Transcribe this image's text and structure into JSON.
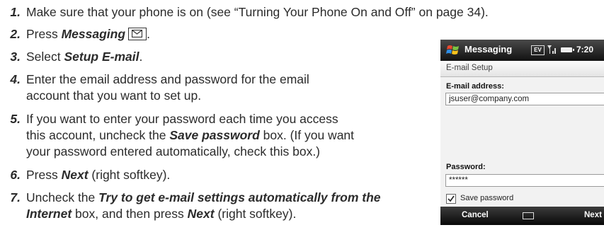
{
  "steps": [
    {
      "number": "1.",
      "parts": [
        "Make sure that your phone is on (see “Turning Your Phone On and Off” on page 34)."
      ]
    },
    {
      "number": "2.",
      "before": "Press ",
      "em": "Messaging",
      "key_icon": "envelope-icon"
    },
    {
      "number": "3.",
      "before": "Select ",
      "em": "Setup E-mail",
      "after": "."
    },
    {
      "number": "4.",
      "lines": [
        "Enter the email address and password for the email",
        "account that you want to set up."
      ]
    },
    {
      "number": "5.",
      "line1": "If you want to enter your password each time you access",
      "line2_before": "this account, uncheck the ",
      "line2_em": "Save password",
      "line2_after": " box. (If you want",
      "line3": "your password entered automatically, check this box.)"
    },
    {
      "number": "6.",
      "before": "Press ",
      "em": "Next",
      "after": " (right softkey)."
    },
    {
      "number": "7.",
      "before": "Uncheck the ",
      "em1": "Try to get e-mail settings automatically from the",
      "em2": "Internet",
      "after": " box, and then press ",
      "em3": "Next",
      "after2": " (right softkey)."
    }
  ],
  "phone": {
    "app_title": "Messaging",
    "network_badge": "EV",
    "time": "7:20",
    "screen_title": "E-mail Setup",
    "email_label": "E-mail address:",
    "email_value": "jsuser@company.com",
    "password_label": "Password:",
    "password_value": "******",
    "save_password_label": "Save password",
    "save_password_checked": true,
    "left_softkey": "Cancel",
    "right_softkey": "Next",
    "colors": {
      "status_bar": "#1a1a1a",
      "screen_bg": "#f2f2f2"
    }
  }
}
